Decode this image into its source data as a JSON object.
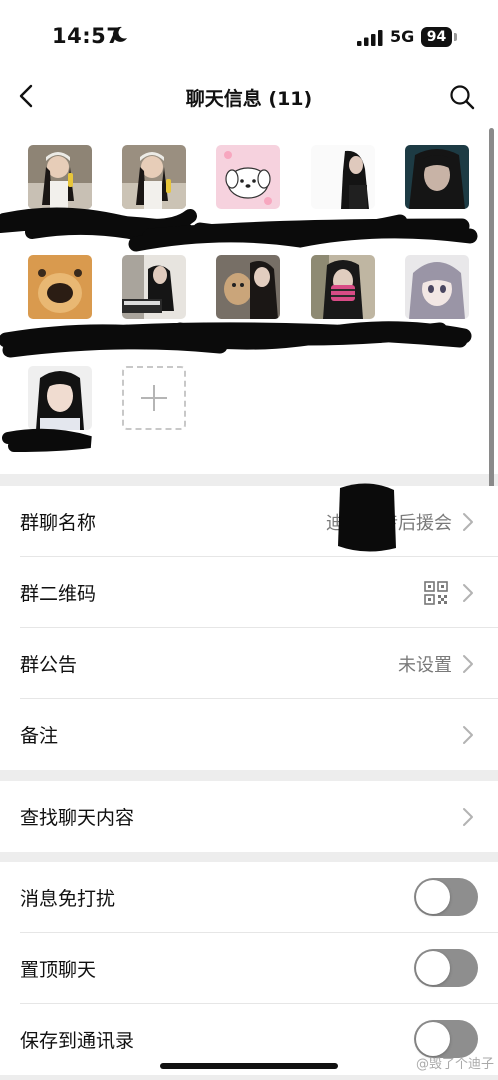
{
  "status_bar": {
    "time": "14:57",
    "network": "5G",
    "battery": "94"
  },
  "nav": {
    "title": "聊天信息 (11)",
    "back_icon": "chevron-left-icon",
    "search_icon": "search-icon"
  },
  "members": [
    {
      "icon": "avatar-girl-with-corn"
    },
    {
      "icon": "avatar-girl-with-corn"
    },
    {
      "icon": "avatar-cartoon-dog-pink"
    },
    {
      "icon": "avatar-dark-haired-woman"
    },
    {
      "icon": "avatar-woman-dark-scene"
    },
    {
      "icon": "avatar-dog-closeup"
    },
    {
      "icon": "avatar-girl-at-keyboard"
    },
    {
      "icon": "avatar-girl-with-dog"
    },
    {
      "icon": "avatar-masked-girl"
    },
    {
      "icon": "avatar-anime-girl"
    },
    {
      "icon": "avatar-woman-portrait"
    }
  ],
  "add_member_icon": "plus-icon",
  "group_settings": {
    "name": {
      "label": "群聊名称",
      "value": "迪姐科传后援会"
    },
    "qr": {
      "label": "群二维码",
      "icon": "qr-code-icon"
    },
    "notice": {
      "label": "群公告",
      "value": "未设置"
    },
    "remark": {
      "label": "备注"
    }
  },
  "search_history": {
    "label": "查找聊天内容"
  },
  "toggles": [
    {
      "label": "消息免打扰",
      "on": false
    },
    {
      "label": "置顶聊天",
      "on": false
    },
    {
      "label": "保存到通讯录",
      "on": false
    }
  ],
  "watermark": "@毁了个迪子",
  "colors": {
    "toggle_off": "#8e8e8e",
    "background": "#ededed",
    "value_text": "#7a7a7a"
  }
}
